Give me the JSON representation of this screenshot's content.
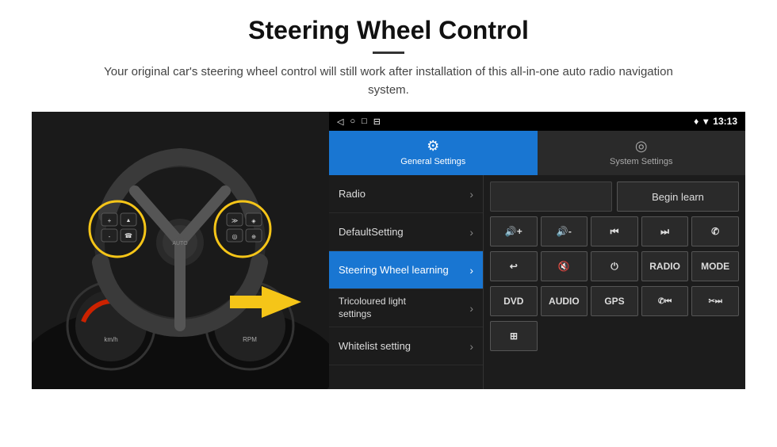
{
  "header": {
    "title": "Steering Wheel Control",
    "divider": true,
    "subtitle": "Your original car's steering wheel control will still work after installation of this all-in-one auto radio navigation system."
  },
  "statusBar": {
    "leftIcons": [
      "◁",
      "○",
      "□",
      "⊟"
    ],
    "rightIcons": [
      "♦",
      "▾"
    ],
    "time": "13:13"
  },
  "tabs": [
    {
      "id": "general",
      "icon": "⚙",
      "label": "General Settings",
      "active": true
    },
    {
      "id": "system",
      "icon": "◎",
      "label": "System Settings",
      "active": false
    }
  ],
  "menu": [
    {
      "id": "radio",
      "label": "Radio",
      "active": false
    },
    {
      "id": "default",
      "label": "DefaultSetting",
      "active": false
    },
    {
      "id": "steering",
      "label": "Steering Wheel learning",
      "active": true
    },
    {
      "id": "tricoloured",
      "label": "Tricoloured light settings",
      "active": false
    },
    {
      "id": "whitelist",
      "label": "Whitelist setting",
      "active": false
    }
  ],
  "rightPanel": {
    "beginLearnLabel": "Begin learn",
    "row2": [
      "🔊+",
      "🔊-",
      "⏮",
      "⏭",
      "📞"
    ],
    "row2Raw": [
      "◀+",
      "◀-",
      "⏮",
      "⏭",
      "☎"
    ],
    "row3": [
      "↩",
      "🔇",
      "⏻",
      "RADIO",
      "MODE"
    ],
    "row4": [
      "DVD",
      "AUDIO",
      "GPS",
      "☎⏮",
      "✂⏭"
    ],
    "row5": [
      "⊞"
    ]
  },
  "icons": {
    "volUp": "◀+",
    "volDown": "◀-",
    "prevTrack": "⏮",
    "nextTrack": "⏭",
    "phone": "✆",
    "back": "↩",
    "mute": "🔇",
    "power": "⏻",
    "radio": "RADIO",
    "mode": "MODE",
    "dvd": "DVD",
    "audio": "AUDIO",
    "gps": "GPS",
    "phoneNext": "✆⏮",
    "skipBack": "✂⏭",
    "list": "⊞"
  }
}
